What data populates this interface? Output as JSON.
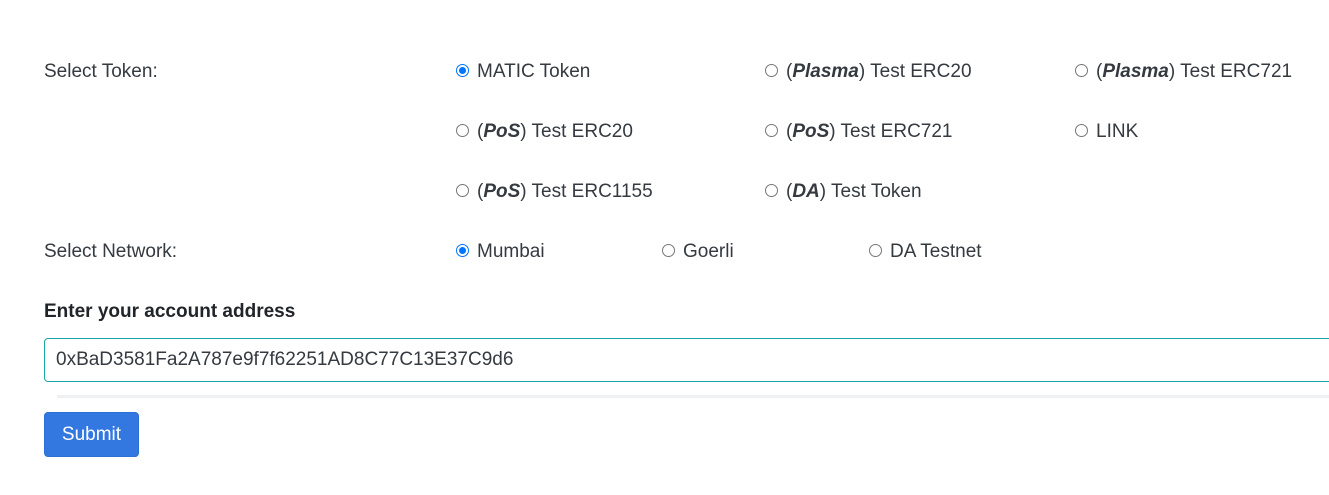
{
  "token_section": {
    "label": "Select Token:",
    "options": [
      {
        "prefix": "",
        "emph": "",
        "suffix": "MATIC Token",
        "checked": true
      },
      {
        "prefix": "(",
        "emph": "Plasma",
        "suffix": ") Test ERC20",
        "checked": false
      },
      {
        "prefix": "(",
        "emph": "Plasma",
        "suffix": ") Test ERC721",
        "checked": false
      },
      {
        "prefix": "(",
        "emph": "PoS",
        "suffix": ") Test ERC20",
        "checked": false
      },
      {
        "prefix": "(",
        "emph": "PoS",
        "suffix": ") Test ERC721",
        "checked": false
      },
      {
        "prefix": "",
        "emph": "",
        "suffix": "LINK",
        "checked": false
      },
      {
        "prefix": "(",
        "emph": "PoS",
        "suffix": ") Test ERC1155",
        "checked": false
      },
      {
        "prefix": "(",
        "emph": "DA",
        "suffix": ") Test Token",
        "checked": false
      }
    ]
  },
  "network_section": {
    "label": "Select Network:",
    "options": [
      {
        "label": "Mumbai",
        "checked": true
      },
      {
        "label": "Goerli",
        "checked": false
      },
      {
        "label": "DA Testnet",
        "checked": false
      }
    ]
  },
  "address_section": {
    "label": "Enter your account address",
    "value": "0xBaD3581Fa2A787e9f7f62251AD8C77C13E37C9d6"
  },
  "submit_label": "Submit",
  "colors": {
    "radio_accent": "#0075ff",
    "input_border": "#1aa6a6",
    "button_bg": "#3377e0"
  }
}
